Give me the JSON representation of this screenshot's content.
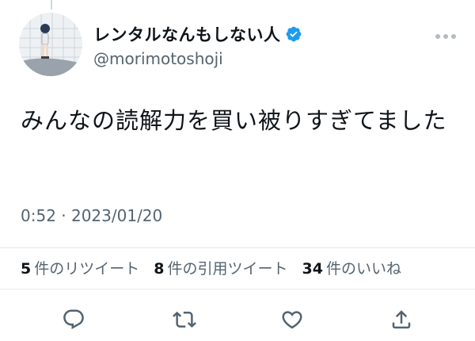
{
  "tweet": {
    "author": {
      "display_name": "レンタルなんもしない人",
      "handle": "@morimotoshoji",
      "verified": true,
      "avatar": "avatar-photo"
    },
    "text": "みんなの読解力を買い被りすぎてました",
    "timestamp": "0:52 · 2023/01/20",
    "stats": {
      "retweets": {
        "count": "5",
        "label": "件のリツイート"
      },
      "quotes": {
        "count": "8",
        "label": "件の引用ツイート"
      },
      "likes": {
        "count": "34",
        "label": "件のいいね"
      }
    },
    "actions": [
      {
        "icon": "reply-icon"
      },
      {
        "icon": "retweet-icon"
      },
      {
        "icon": "like-icon"
      },
      {
        "icon": "share-icon"
      }
    ]
  },
  "colors": {
    "text_primary": "#0f1419",
    "text_secondary": "#536471",
    "verified_blue": "#1d9bf0",
    "divider": "#e4e9ed"
  }
}
